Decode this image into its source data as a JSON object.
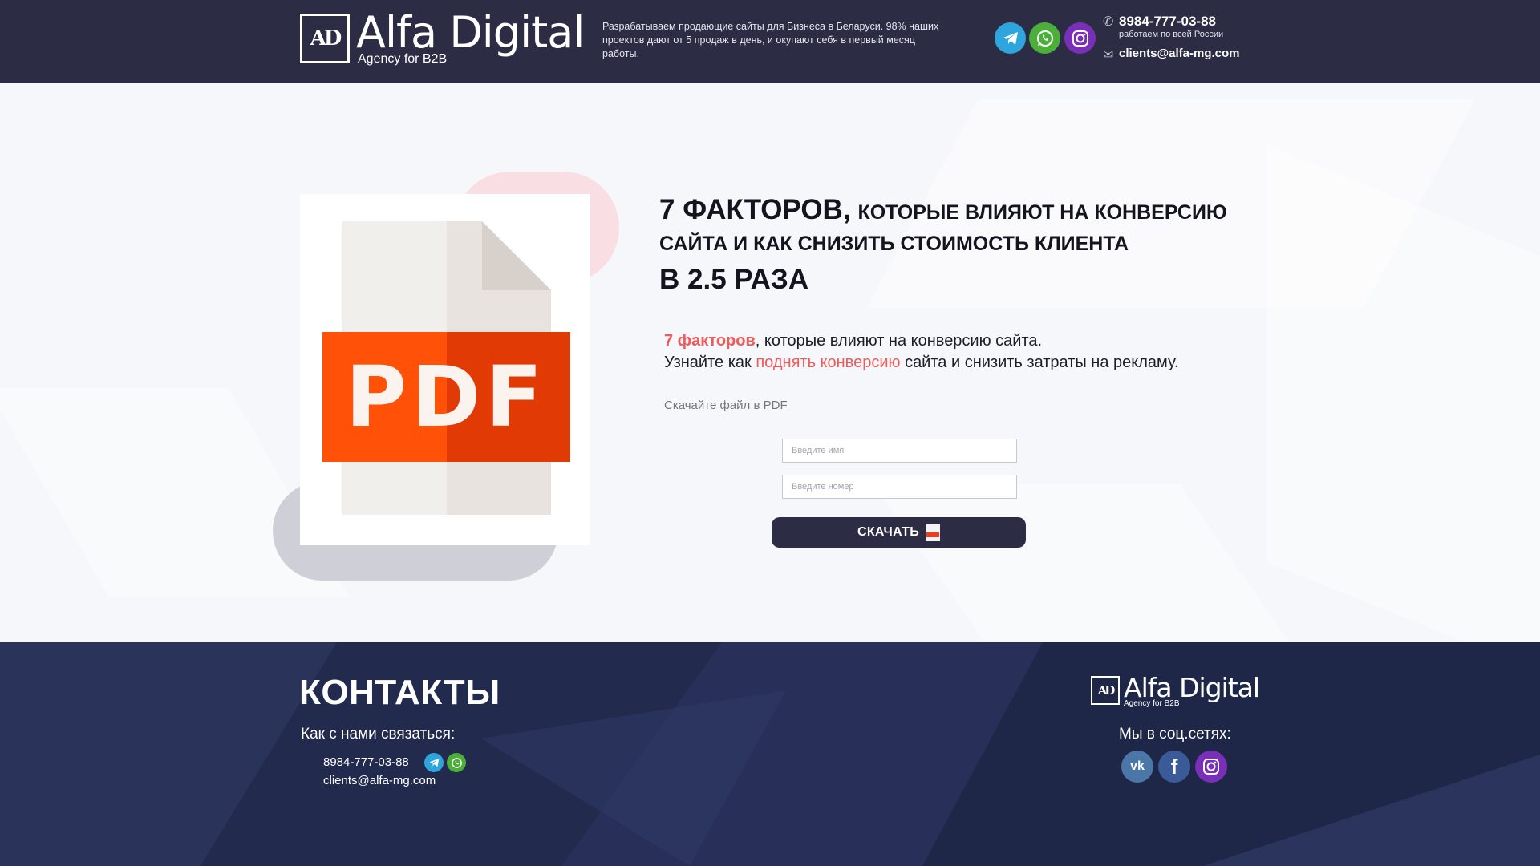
{
  "header": {
    "logo": {
      "mark": "AD",
      "title": "Alfa Digital",
      "subtitle": "Agency for B2B"
    },
    "tagline": "Разрабатываем продающие сайты для Бизнеса в Беларуси. 98% наших проектов дают от 5 продаж в день, и окупают себя в первый месяц работы.",
    "social": [
      {
        "name": "telegram-icon",
        "color": "#2ea6dd"
      },
      {
        "name": "whatsapp-icon",
        "color": "#4caf3a"
      },
      {
        "name": "instagram-icon",
        "color": "#7a2fb8"
      }
    ],
    "phone": "8984-777-03-88",
    "phone_note": "работаем по всей России",
    "email": "clients@alfa-mg.com"
  },
  "main": {
    "pdf_label": "PDF",
    "headline": {
      "line1_big": "7 факторов,",
      "line1_rest": "которые влияют на конверсию",
      "line2": "сайта и как снизить стоимость клиента",
      "line3": "в 2.5 раза"
    },
    "subtext": {
      "accent1": "7 факторов",
      "part1": ", которые влияют на конверсию сайта.",
      "part2": "Узнайте как",
      "accent2": "поднять конверсию",
      "part3": "сайта и снизить затраты на рекламу."
    },
    "download_note": "Скачайте файл в PDF",
    "form": {
      "name_placeholder": "Введите имя",
      "phone_placeholder": "Введите номер",
      "button_label": "СКАЧАТЬ"
    }
  },
  "footer": {
    "title": "КОНТАКТЫ",
    "how_contact": "Как с нами связаться:",
    "phone": "8984-777-03-88",
    "email": "clients@alfa-mg.com",
    "logo": {
      "mark": "AD",
      "title": "Alfa Digital",
      "subtitle": "Agency for B2B"
    },
    "social_label": "Мы в соц.сетях:",
    "social": [
      {
        "name": "vk-icon",
        "label": "vk",
        "color": "#4a76a8"
      },
      {
        "name": "facebook-icon",
        "label": "f",
        "color": "#3b5a98"
      },
      {
        "name": "instagram-icon",
        "color": "#7a2fb8"
      }
    ]
  },
  "colors": {
    "header_bg": "#2c2c45",
    "footer_bg": "#242c52",
    "accent": "#f05a5a",
    "pdf_orange": "#ff5208",
    "pdf_red": "#e23a04"
  }
}
